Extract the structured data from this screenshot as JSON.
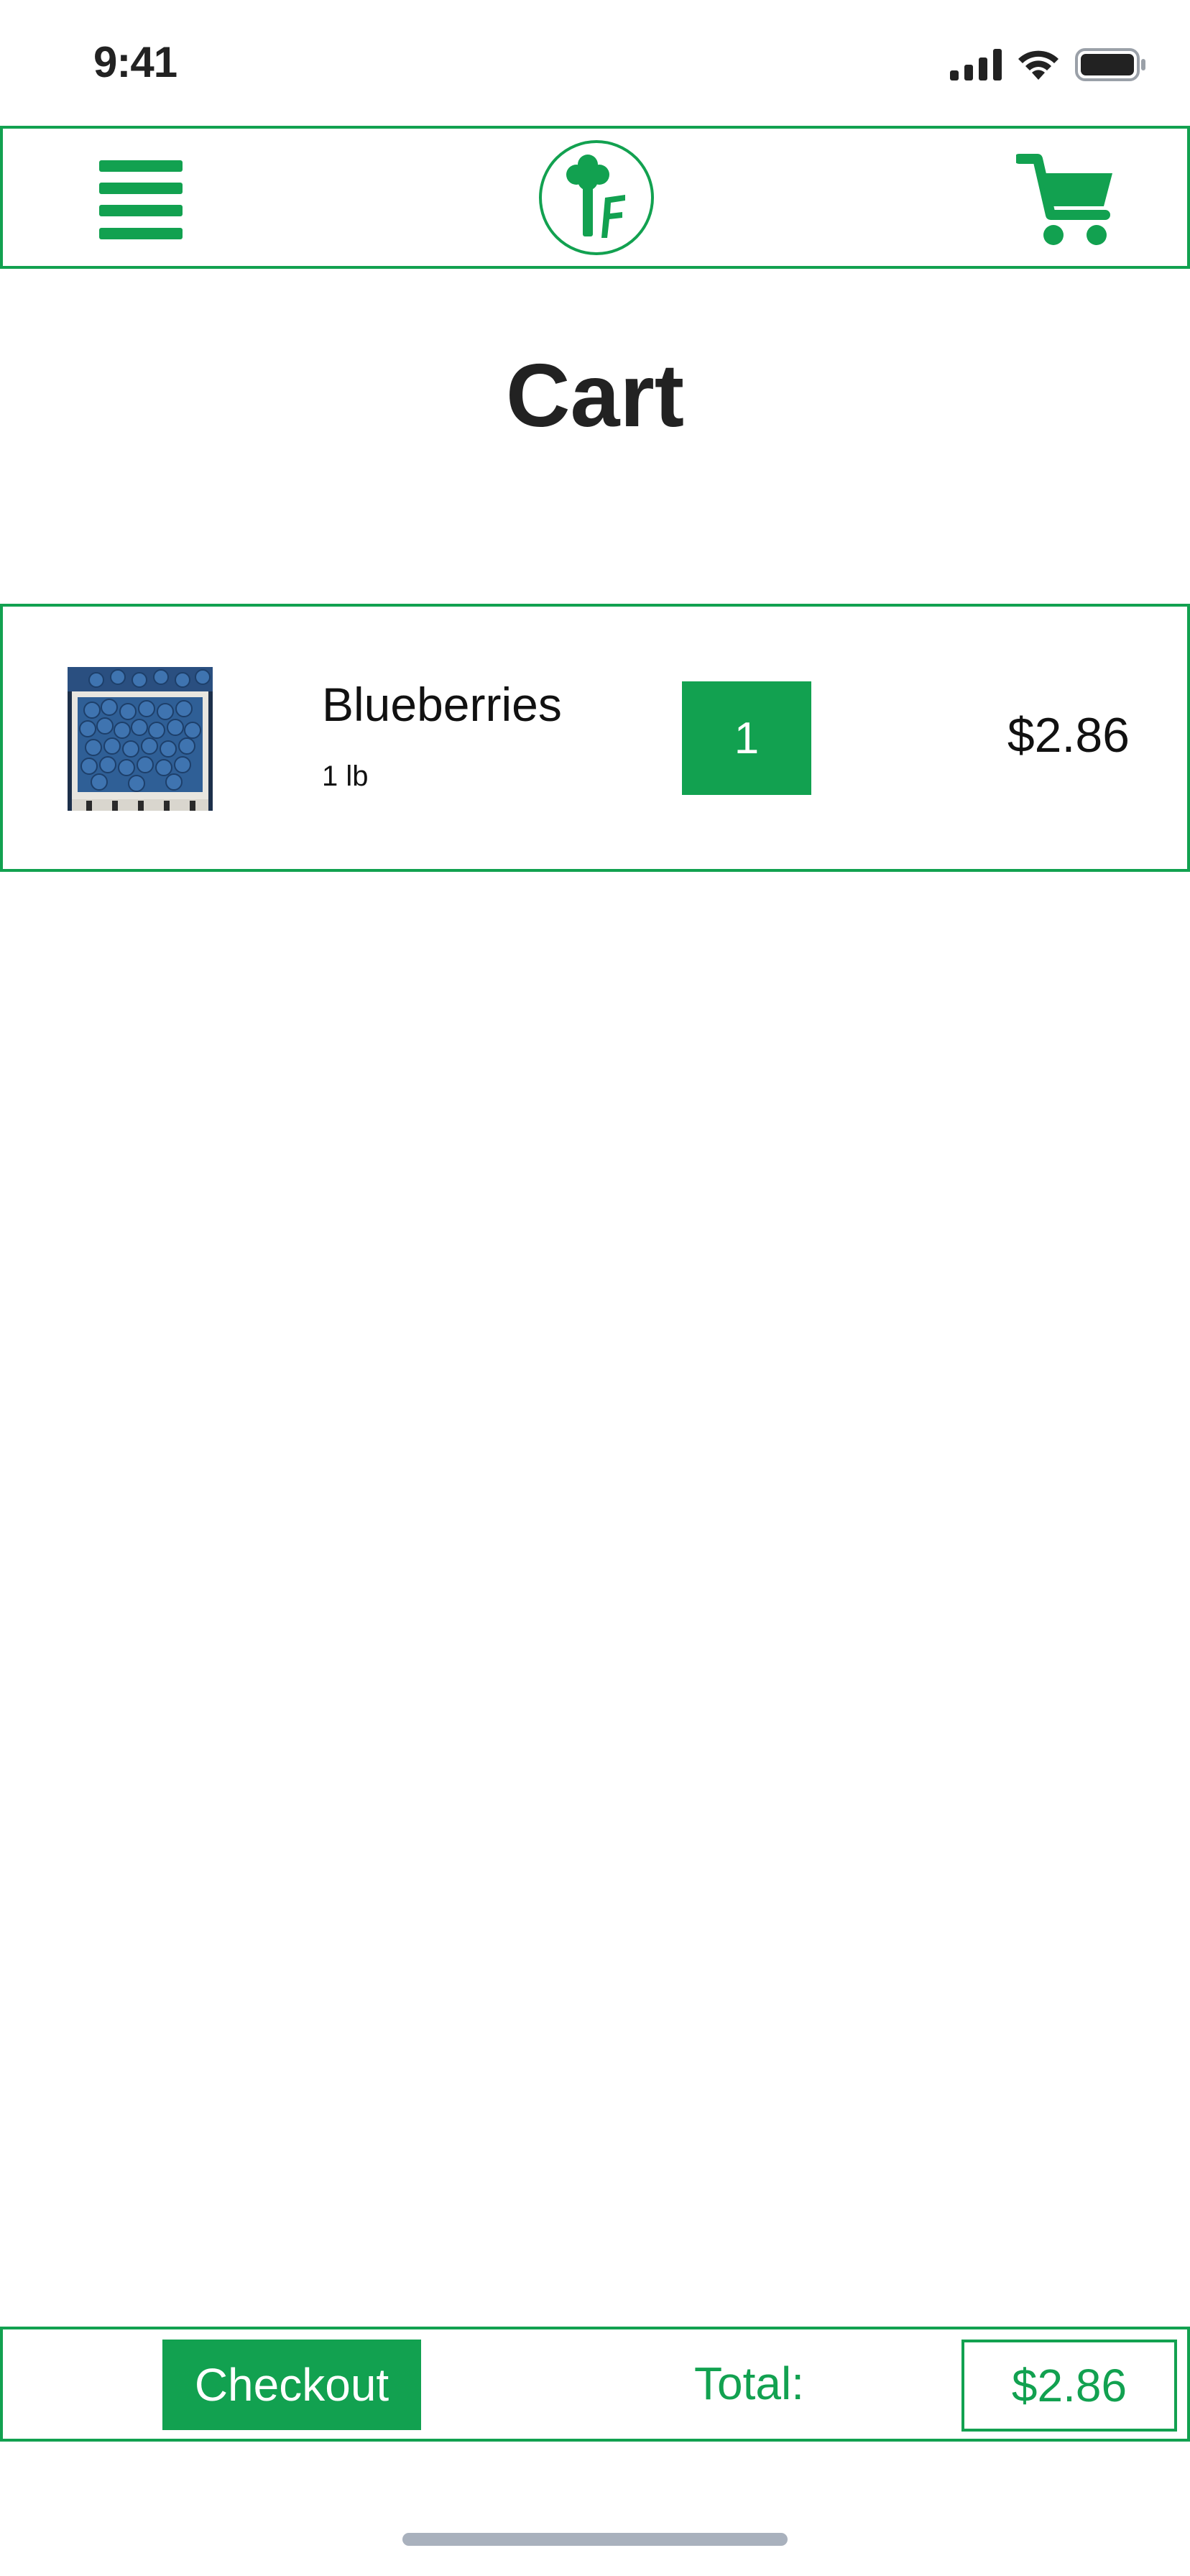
{
  "status_bar": {
    "time": "9:41",
    "icons": [
      "cellular-signal-icon",
      "wifi-icon",
      "battery-icon"
    ]
  },
  "header": {
    "menu_icon": "hamburger-menu-icon",
    "logo_icon": "tree-f-logo",
    "cart_icon": "shopping-cart-icon"
  },
  "page": {
    "title": "Cart"
  },
  "cart": {
    "items": [
      {
        "name": "Blueberries",
        "weight": "1 lb",
        "quantity": "1",
        "price": "$2.86",
        "image": "blueberries-basket-photo"
      }
    ]
  },
  "footer": {
    "checkout_label": "Checkout",
    "total_label": "Total:",
    "total_value": "$2.86"
  },
  "colors": {
    "accent": "#12a150",
    "text": "#111111",
    "blueberry": "#2f5f96"
  }
}
